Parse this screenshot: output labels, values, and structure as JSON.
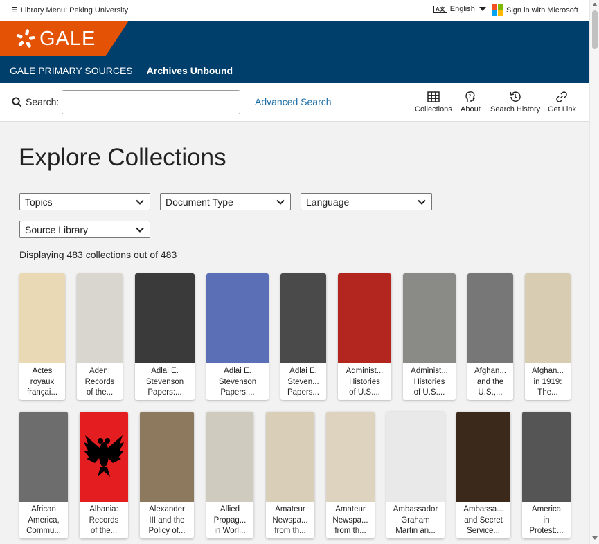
{
  "utility": {
    "library_menu": "Library Menu: Peking University",
    "language": "English",
    "signin": "Sign in with Microsoft",
    "ms_colors": [
      "#f25022",
      "#7fba00",
      "#00a4ef",
      "#ffb900"
    ]
  },
  "header": {
    "logo": "GALE",
    "nav": [
      "GALE PRIMARY SOURCES",
      "Archives Unbound"
    ],
    "brand_color": "#003e6b",
    "accent_color": "#e35205"
  },
  "search": {
    "label": "Search:",
    "placeholder": "",
    "advanced": "Advanced Search"
  },
  "tools": [
    "Collections",
    "About",
    "Search History",
    "Get Link"
  ],
  "page": {
    "title": "Explore Collections",
    "filters": [
      "Topics",
      "Document Type",
      "Language",
      "Source Library"
    ],
    "count": "Displaying 483 collections out of 483"
  },
  "cards_row1": [
    {
      "lines": [
        "Actes",
        "royaux",
        "françai..."
      ],
      "color": "#e9d9b4",
      "icon": "sun-engraving"
    },
    {
      "lines": [
        "Aden:",
        "Records",
        "of the..."
      ],
      "color": "#d8d6cf",
      "icon": "map"
    },
    {
      "lines": [
        "Adlai E.",
        "Stevenson",
        "Papers:..."
      ],
      "color": "#3a3a3a",
      "icon": "photo"
    },
    {
      "lines": [
        "Adlai E.",
        "Stevenson",
        "Papers:..."
      ],
      "color": "#5b6fb6",
      "icon": "poster"
    },
    {
      "lines": [
        "Adlai E.",
        "Steven...",
        "Papers..."
      ],
      "color": "#4a4a4a",
      "icon": "photo"
    },
    {
      "lines": [
        "Administ...",
        "Histories",
        "of U.S...."
      ],
      "color": "#b3251f",
      "icon": "poster"
    },
    {
      "lines": [
        "Administ...",
        "Histories",
        "of U.S...."
      ],
      "color": "#8a8a86",
      "icon": "poster"
    },
    {
      "lines": [
        "Afghan...",
        "and the",
        "U.S.,..."
      ],
      "color": "#777",
      "icon": "photo"
    },
    {
      "lines": [
        "Afghan...",
        "in 1919:",
        "The..."
      ],
      "color": "#d8ccb2",
      "icon": "document"
    }
  ],
  "cards_row2": [
    {
      "lines": [
        "African",
        "America,",
        "Commu..."
      ],
      "color": "#6d6d6d",
      "icon": "photo"
    },
    {
      "lines": [
        "Albania:",
        "Records",
        "of the..."
      ],
      "color": "#e41e20",
      "icon": "flag"
    },
    {
      "lines": [
        "Alexander",
        "III and the",
        "Policy of..."
      ],
      "color": "#8d7a5e",
      "icon": "photo"
    },
    {
      "lines": [
        "Allied",
        "Propag...",
        "in Worl..."
      ],
      "color": "#cfcbbf",
      "icon": "poster"
    },
    {
      "lines": [
        "Amateur",
        "Newspa...",
        "from th..."
      ],
      "color": "#d9cfb8",
      "icon": "document"
    },
    {
      "lines": [
        "Amateur",
        "Newspa...",
        "from th..."
      ],
      "color": "#ddd3bf",
      "icon": "document"
    },
    {
      "lines": [
        "Ambassador",
        "Graham",
        "Martin an..."
      ],
      "color": "#e9e9e9",
      "icon": "document"
    },
    {
      "lines": [
        "Ambassa...",
        "and Secret",
        "Service..."
      ],
      "color": "#3b2a1c",
      "icon": "painting"
    },
    {
      "lines": [
        "America",
        "in",
        "Protest:..."
      ],
      "color": "#555",
      "icon": "photo"
    }
  ]
}
